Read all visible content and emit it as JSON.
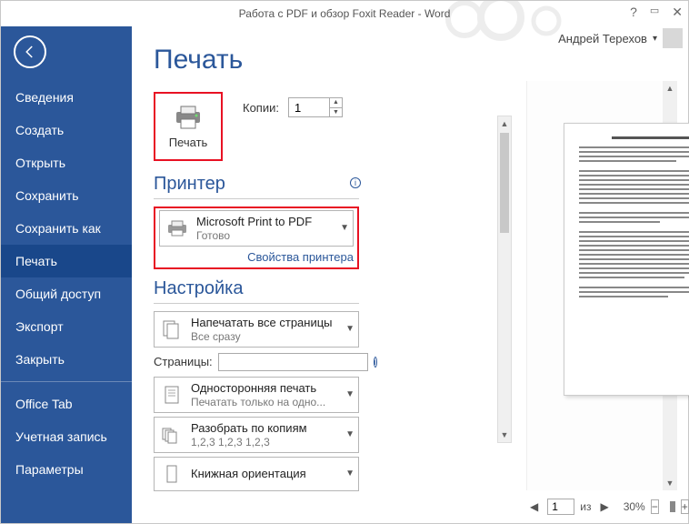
{
  "window": {
    "title": "Работа с PDF и обзор Foxit Reader - Word"
  },
  "user": {
    "name": "Андрей Терехов"
  },
  "sidebar": {
    "items": [
      "Сведения",
      "Создать",
      "Открыть",
      "Сохранить",
      "Сохранить как",
      "Печать",
      "Общий доступ",
      "Экспорт",
      "Закрыть",
      "Office Tab",
      "Учетная запись",
      "Параметры"
    ],
    "active": 5
  },
  "page": {
    "title": "Печать"
  },
  "print_button": {
    "label": "Печать"
  },
  "copies": {
    "label": "Копии:",
    "value": "1"
  },
  "printer": {
    "section": "Принтер",
    "name": "Microsoft Print to PDF",
    "status": "Готово",
    "props_link": "Свойства принтера"
  },
  "settings": {
    "section": "Настройка",
    "print_what": {
      "t1": "Напечатать все страницы",
      "t2": "Все сразу"
    },
    "pages_label": "Страницы:",
    "pages_value": "",
    "duplex": {
      "t1": "Односторонняя печать",
      "t2": "Печатать только на одно..."
    },
    "collate": {
      "t1": "Разобрать по копиям",
      "t2": "1,2,3    1,2,3    1,2,3"
    },
    "orient": {
      "t1": "Книжная ориентация",
      "t2": ""
    }
  },
  "status": {
    "page_current": "1",
    "page_sep": "из",
    "zoom": "30%"
  }
}
